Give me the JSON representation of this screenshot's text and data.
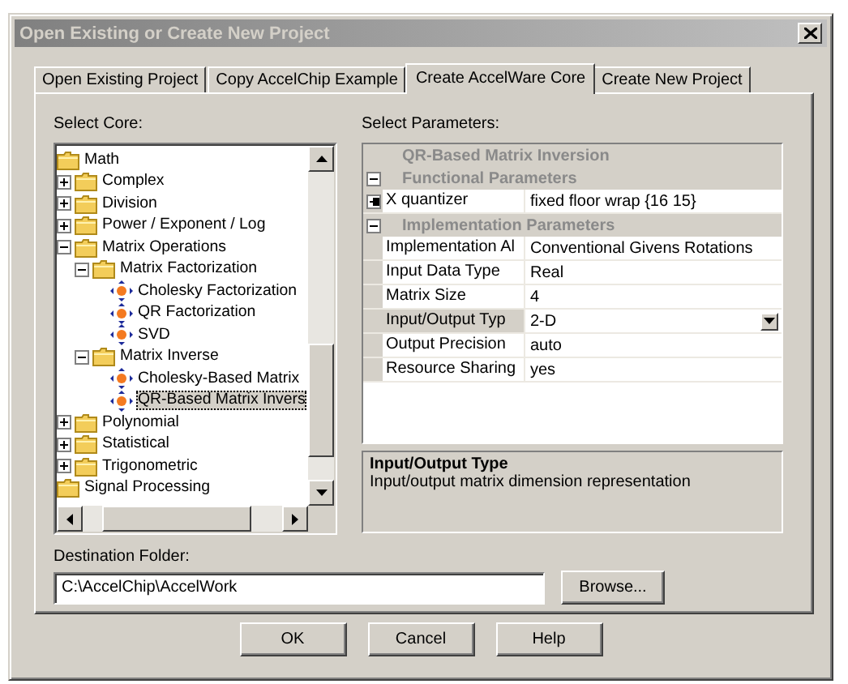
{
  "window": {
    "title": "Open Existing or Create New Project"
  },
  "tabs": [
    {
      "label": "Open Existing Project",
      "selected": false
    },
    {
      "label": "Copy AccelChip Example",
      "selected": false
    },
    {
      "label": "Create AccelWare Core",
      "selected": true
    },
    {
      "label": "Create New Project",
      "selected": false
    }
  ],
  "select_core": {
    "label": "Select Core:",
    "tree": [
      {
        "label": "Math",
        "kind": "folder",
        "selected": false,
        "children": [
          {
            "label": "Complex",
            "kind": "folder",
            "expanded": false,
            "selected": false
          },
          {
            "label": "Division",
            "kind": "folder",
            "expanded": false,
            "selected": false
          },
          {
            "label": "Power / Exponent / Log",
            "kind": "folder",
            "expanded": false,
            "selected": false
          },
          {
            "label": "Matrix Operations",
            "kind": "folder",
            "expanded": true,
            "selected": false,
            "children": [
              {
                "label": "Matrix Factorization",
                "kind": "folder",
                "expanded": true,
                "selected": false,
                "children": [
                  {
                    "label": "Cholesky Factorization",
                    "kind": "core",
                    "selected": false
                  },
                  {
                    "label": "QR Factorization",
                    "kind": "core",
                    "selected": false
                  },
                  {
                    "label": "SVD",
                    "kind": "core",
                    "selected": false
                  }
                ]
              },
              {
                "label": "Matrix Inverse",
                "kind": "folder",
                "expanded": true,
                "selected": false,
                "children": [
                  {
                    "label": "Cholesky-Based Matrix",
                    "kind": "core",
                    "selected": false
                  },
                  {
                    "label": "QR-Based Matrix Invers",
                    "kind": "core",
                    "selected": true
                  }
                ]
              }
            ]
          },
          {
            "label": "Polynomial",
            "kind": "folder",
            "expanded": false,
            "selected": false
          },
          {
            "label": "Statistical",
            "kind": "folder",
            "expanded": false,
            "selected": false
          },
          {
            "label": "Trigonometric",
            "kind": "folder",
            "expanded": false,
            "selected": false
          }
        ]
      },
      {
        "label": "Signal Processing",
        "kind": "folder",
        "selected": false
      }
    ]
  },
  "select_parameters": {
    "label": "Select Parameters:",
    "title": "QR-Based Matrix Inversion",
    "groups": [
      {
        "name": "Functional Parameters",
        "expanded": true,
        "rows": [
          {
            "name": "X quantizer",
            "value": "fixed floor wrap {16 15}",
            "expandable": true,
            "expanded": false,
            "selected": false
          }
        ]
      },
      {
        "name": "Implementation Parameters",
        "expanded": true,
        "rows": [
          {
            "name": "Implementation Al",
            "value": "Conventional Givens Rotations",
            "expandable": false,
            "selected": false
          },
          {
            "name": "Input Data Type",
            "value": "Real",
            "expandable": false,
            "selected": false
          },
          {
            "name": "Matrix Size",
            "value": "4",
            "expandable": false,
            "selected": false
          },
          {
            "name": "Input/Output Typ",
            "value": "2-D",
            "expandable": false,
            "selected": true
          },
          {
            "name": "Output Precision",
            "value": "auto",
            "expandable": false,
            "selected": false
          },
          {
            "name": "Resource Sharing",
            "value": "yes",
            "expandable": false,
            "selected": false
          }
        ]
      }
    ]
  },
  "description": {
    "title": "Input/Output Type",
    "text": "Input/output matrix dimension representation"
  },
  "destination": {
    "label": "Destination Folder:",
    "value": "C:\\AccelChip\\AccelWork",
    "button": "Browse..."
  },
  "buttons": [
    "OK",
    "Cancel",
    "Help"
  ]
}
